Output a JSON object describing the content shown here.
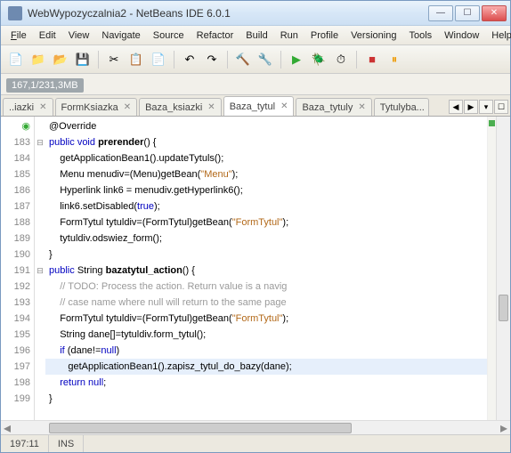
{
  "window": {
    "title": "WebWypozyczalnia2 - NetBeans IDE 6.0.1"
  },
  "menu": {
    "file": "File",
    "edit": "Edit",
    "view": "View",
    "navigate": "Navigate",
    "source": "Source",
    "refactor": "Refactor",
    "build": "Build",
    "run": "Run",
    "profile": "Profile",
    "versioning": "Versioning",
    "tools": "Tools",
    "window": "Window",
    "help": "Help"
  },
  "memory": {
    "text": "167,1/231,3MB"
  },
  "tabs": {
    "t0": "..iazki",
    "t1": "FormKsiazka",
    "t2": "Baza_ksiazki",
    "t3": "Baza_tytul",
    "t4": "Baza_tytuly",
    "t5": "Tytulyba..."
  },
  "lines": {
    "override": "@Override",
    "l183": {
      "n": "183"
    },
    "l184": {
      "n": "184"
    },
    "l185": {
      "n": "185"
    },
    "l186": {
      "n": "186"
    },
    "l187": {
      "n": "187"
    },
    "l188": {
      "n": "188"
    },
    "l189": {
      "n": "189"
    },
    "l190": {
      "n": "190"
    },
    "l191": {
      "n": "191"
    },
    "l192": {
      "n": "192"
    },
    "l193": {
      "n": "193"
    },
    "l194": {
      "n": "194"
    },
    "l195": {
      "n": "195"
    },
    "l196": {
      "n": "196"
    },
    "l197": {
      "n": "197"
    },
    "l198": {
      "n": "198"
    },
    "l199": {
      "n": "199"
    }
  },
  "code": {
    "kw_public": "public",
    "kw_void": "void",
    "kw_true": "true",
    "kw_String": "String",
    "kw_if": "if",
    "kw_null": "null",
    "kw_return": "return",
    "fn_prerender": "prerender",
    "fn_bazatytul": "bazatytul_action",
    "c183a": " ",
    "c183b": "() {",
    "c184": "    getApplicationBean1().updateTytuls();",
    "c185a": "    Menu menudiv=(Menu)getBean(",
    "c185s": "\"Menu\"",
    "c185b": ");",
    "c186": "    Hyperlink link6 = menudiv.getHyperlink6();",
    "c187a": "    link6.setDisabled(",
    "c187b": ");",
    "c188a": "    FormTytul tytuldiv=(FormTytul)getBean(",
    "c188s": "\"FormTytul\"",
    "c188b": ");",
    "c189": "    tytuldiv.odswiez_form();",
    "c190": "}",
    "c191b": "() {",
    "c192": "    // TODO: Process the action. Return value is a navig",
    "c193": "    // case name where null will return to the same page",
    "c194a": "    FormTytul tytuldiv=(FormTytul)getBean(",
    "c194s": "\"FormTytul\"",
    "c194b": ");",
    "c195": "    String dane[]=tytuldiv.form_tytul();",
    "c196a": "    ",
    "c196b": " (dane!=",
    "c196c": ")",
    "c197": "       getApplicationBean1().zapisz_tytul_do_bazy(dane);",
    "c198a": "    ",
    "c198b": " ",
    "c198c": ";",
    "c199": "}"
  },
  "status": {
    "pos": "197:11",
    "mode": "INS"
  }
}
